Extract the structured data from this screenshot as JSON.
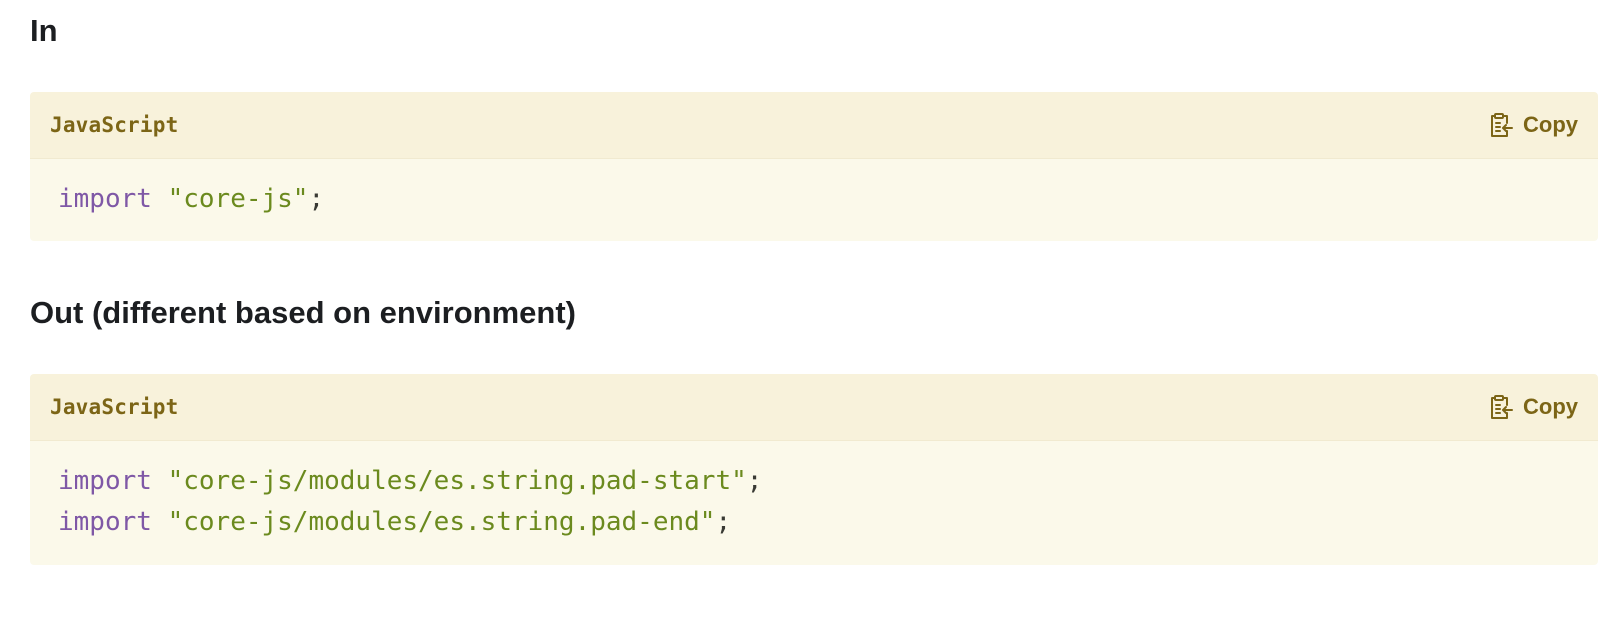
{
  "sections": [
    {
      "heading": "In",
      "code": {
        "language": "JavaScript",
        "copy_label": "Copy",
        "copy_icon": "clipboard-icon",
        "lines": [
          {
            "keyword": "import",
            "string": "\"core-js\"",
            "punct": ";"
          }
        ]
      }
    },
    {
      "heading": "Out (different based on environment)",
      "code": {
        "language": "JavaScript",
        "copy_label": "Copy",
        "copy_icon": "clipboard-icon",
        "lines": [
          {
            "keyword": "import",
            "string": "\"core-js/modules/es.string.pad-start\"",
            "punct": ";"
          },
          {
            "keyword": "import",
            "string": "\"core-js/modules/es.string.pad-end\"",
            "punct": ";"
          }
        ]
      }
    }
  ],
  "colors": {
    "header_bg": "#f8f2db",
    "body_bg": "#fbf9ea",
    "accent": "#7c6516",
    "keyword": "#7f58a6",
    "string": "#6b8a1e"
  }
}
